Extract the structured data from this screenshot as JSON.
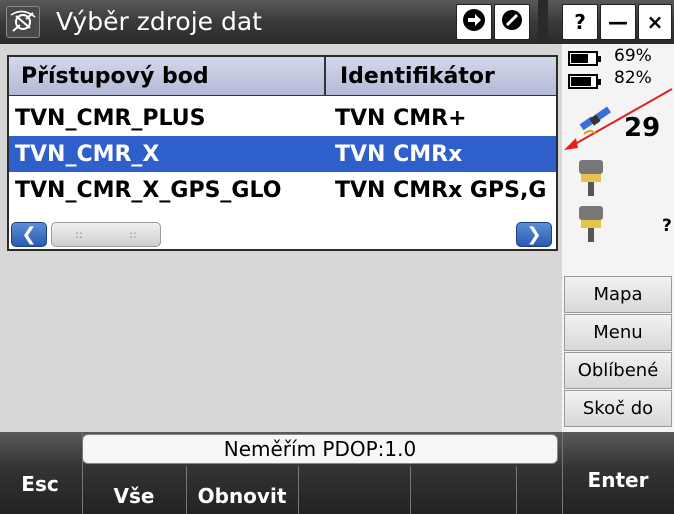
{
  "window": {
    "title": "Výběr zdroje dat",
    "help_label": "?",
    "minimize_label": "—",
    "close_label": "×"
  },
  "table": {
    "columns": [
      "Přístupový bod",
      "Identifikátor"
    ],
    "rows": [
      {
        "name": "TVN_CMR_PLUS",
        "id": "TVN CMR+",
        "selected": false
      },
      {
        "name": "TVN_CMR_X",
        "id": "TVN CMRx",
        "selected": true
      },
      {
        "name": "TVN_CMR_X_GPS_GLO",
        "id": "TVN CMRx GPS,G",
        "selected": false
      }
    ]
  },
  "status_panel": {
    "battery1": "69%",
    "battery2": "82%",
    "battery1_level": 0.69,
    "battery2_level": 0.82,
    "satellites": "29",
    "unknown": "?"
  },
  "side_buttons": [
    {
      "label": "Mapa"
    },
    {
      "label": "Menu"
    },
    {
      "label": "Oblíbené"
    },
    {
      "label": "Skoč do"
    }
  ],
  "status_line": "Neměřím  PDOP:1.0",
  "softkeys": {
    "esc": "Esc",
    "all": "Vše",
    "refresh": "Obnovit",
    "enter": "Enter"
  },
  "colors": {
    "selection": "#2f5fcb",
    "header": "#b3b9d7",
    "accent_arrow": "#e02020"
  }
}
